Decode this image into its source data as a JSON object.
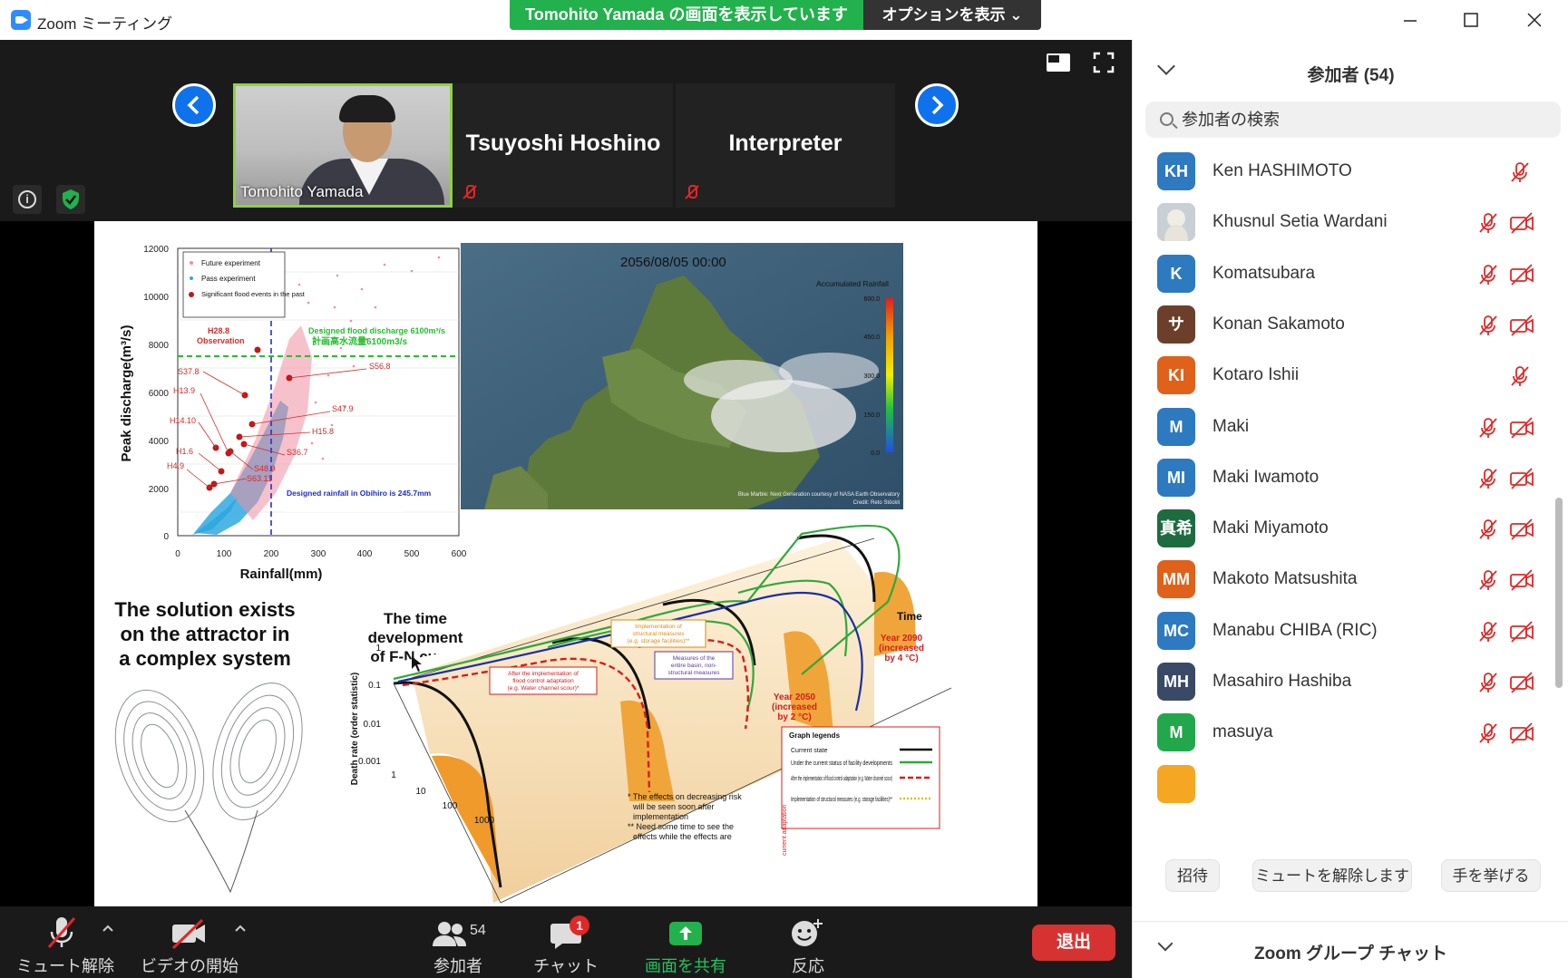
{
  "window": {
    "title": "Zoom ミーティング",
    "share_banner": "Tomohito Yamada の画面を表示しています",
    "options_label": "オプションを表示 ⌄"
  },
  "video_strip": {
    "tiles": [
      {
        "name": "Tomohito Yamada",
        "type": "video"
      },
      {
        "name": "Tsuyoshi Hoshino",
        "type": "name",
        "muted": true
      },
      {
        "name": "Interpreter",
        "type": "name",
        "muted": true
      }
    ]
  },
  "slide": {
    "plot": {
      "ylabel": "Peak discharge(m³/s)",
      "xlabel": "Rainfall(mm)",
      "yticks": [
        "12000",
        "10000",
        "8000",
        "6000",
        "4000",
        "2000",
        "0"
      ],
      "xticks": [
        "0",
        "100",
        "200",
        "300",
        "400",
        "500",
        "600"
      ],
      "legend": [
        "Future experiment",
        "Pass experiment",
        "Significant flood events in the past"
      ],
      "design_line_en": "Designed flood discharge 6100m³/s",
      "design_line_ja": "計画高水流量6100m3/s",
      "h28": "H28.8",
      "observation": "Observation",
      "rain_note": "Designed rainfall in Obihiro is 245.7mm",
      "points": [
        "S37.8",
        "H13.9",
        "H14.10",
        "H1.6",
        "H4.9",
        "S56.8",
        "S47.9",
        "H15.8",
        "S36.7",
        "S48.9",
        "S63.11"
      ]
    },
    "map": {
      "timestamp": "2056/08/05 00:00",
      "legend_title": "Accumulated Rainfall",
      "legend_values": [
        "600.0",
        "450.0",
        "300.0",
        "150.0",
        "0.0"
      ],
      "credit1": "Blue Marble: Next Generation courtesy of NASA Earth Observatory",
      "credit2": "Credit: Reto Stöckli"
    },
    "attractor_text": [
      "The solution exists",
      "on the attractor in",
      "a complex system"
    ],
    "fn_title": [
      "The time",
      "development",
      "of F-N curve"
    ],
    "fn": {
      "time_label": "Time",
      "y_label": "Death rate (order statistic)",
      "y_ticks": [
        "1",
        "0.1",
        "0.01",
        "0.001"
      ],
      "x_ticks": [
        "1",
        "10",
        "100",
        "1000"
      ],
      "year2090": [
        "Year 2090",
        "(increased",
        "by 4 °C)"
      ],
      "year2050": [
        "Year 2050",
        "(increased",
        "by 2 °C)"
      ],
      "box1": [
        "After the implementation of",
        "flood control adaptation",
        "(e.g. Water channel scour)*"
      ],
      "box2": [
        "Implementation of",
        "structural measures",
        "(e.g. storage facilities)**"
      ],
      "box3": [
        "Measures of the",
        "entire basin, non-",
        "structural measures"
      ],
      "notes": [
        "* The effects on decreasing risk",
        "will be seen soon after",
        "implementation",
        "** Need some time to see the",
        "effects while the effects are"
      ],
      "legend_title": "Graph legends",
      "legend_items": [
        "Current state",
        "Under the current status of facility developments",
        "After the implementation of flood control adaptation (e.g. Water channel scour)",
        "Implementation of structural measures (e.g. storage facilities)**"
      ],
      "side_text": "current adaptation"
    }
  },
  "toolbar": {
    "mute": "ミュート解除",
    "video": "ビデオの開始",
    "participants": "参加者",
    "participants_count": "54",
    "chat": "チャット",
    "chat_badge": "1",
    "share": "画面を共有",
    "reactions": "反応",
    "leave": "退出"
  },
  "panel": {
    "title": "参加者 (54)",
    "search_placeholder": "参加者の検索",
    "participants": [
      {
        "initials": "KH",
        "name": "Ken HASHIMOTO",
        "color": "#2d7ac0",
        "cam": false
      },
      {
        "initials": "",
        "name": "Khusnul Setia Wardani",
        "color": "#bfc8d0",
        "cam": true
      },
      {
        "initials": "K",
        "name": "Komatsubara",
        "color": "#2d7ac0",
        "cam": true
      },
      {
        "initials": "サ",
        "name": "Konan Sakamoto",
        "color": "#6b3f2a",
        "cam": true
      },
      {
        "initials": "KI",
        "name": "Kotaro Ishii",
        "color": "#e0611a",
        "cam": false
      },
      {
        "initials": "M",
        "name": "Maki",
        "color": "#2d7ac0",
        "cam": true
      },
      {
        "initials": "MI",
        "name": "Maki Iwamoto",
        "color": "#2d7ac0",
        "cam": true
      },
      {
        "initials": "真希",
        "name": "Maki Miyamoto",
        "color": "#1f6b40",
        "cam": true
      },
      {
        "initials": "MM",
        "name": "Makoto Matsushita",
        "color": "#e0611a",
        "cam": true
      },
      {
        "initials": "MC",
        "name": "Manabu CHIBA (RIC)",
        "color": "#2d7ac0",
        "cam": true
      },
      {
        "initials": "MH",
        "name": "Masahiro Hashiba",
        "color": "#3a4a66",
        "cam": true
      },
      {
        "initials": "M",
        "name": "masuya",
        "color": "#22a84a",
        "cam": true
      }
    ],
    "buttons": [
      "招待",
      "ミュートを解除します",
      "手を挙げる"
    ],
    "chat_title": "Zoom グループ チャット"
  },
  "colors": {
    "banner_green": "#22b14c",
    "zoom_blue": "#0e72ed",
    "leave_red": "#d63232",
    "mute_red": "#e02828"
  }
}
